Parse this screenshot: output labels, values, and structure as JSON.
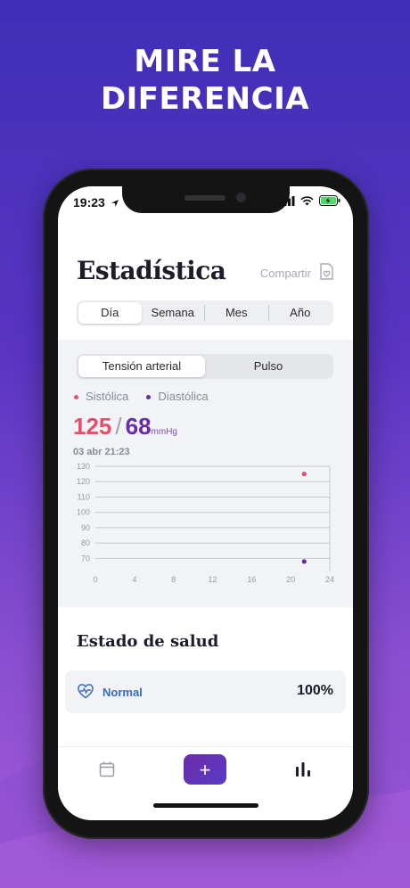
{
  "headline": {
    "line1": "MIRE LA",
    "line2": "DIFERENCIA"
  },
  "status_bar": {
    "time": "19:23"
  },
  "page": {
    "title": "Estadística",
    "share_label": "Compartir"
  },
  "period_tabs": {
    "items": [
      "Día",
      "Semana",
      "Mes",
      "Año"
    ],
    "selected": "Día"
  },
  "metric_tabs": {
    "items": [
      "Tensión arterial",
      "Pulso"
    ],
    "selected": "Tensión arterial"
  },
  "legend": {
    "systolic": "Sistólica",
    "diastolic": "Diastólica"
  },
  "reading": {
    "systolic": "125",
    "separator": "/",
    "diastolic": "68",
    "unit": "mmHg",
    "datetime": "03 abr 21:23"
  },
  "colors": {
    "systolic": "#e94d6a",
    "diastolic": "#6a2ca8",
    "accent": "#5a35c2"
  },
  "chart_data": {
    "type": "scatter",
    "x_ticks": [
      0,
      4,
      8,
      12,
      16,
      20,
      24
    ],
    "y_ticks": [
      70,
      80,
      90,
      100,
      110,
      120,
      130
    ],
    "xlim": [
      0,
      24
    ],
    "ylim": [
      65,
      130
    ],
    "grid": true,
    "series": [
      {
        "name": "Sistólica",
        "points": [
          {
            "x": 21.38,
            "y": 125
          }
        ]
      },
      {
        "name": "Diastólica",
        "points": [
          {
            "x": 21.38,
            "y": 68
          }
        ]
      }
    ]
  },
  "health": {
    "title": "Estado de salud",
    "status": "Normal",
    "percent": "100%"
  },
  "tabbar": {
    "add_label": "+"
  }
}
